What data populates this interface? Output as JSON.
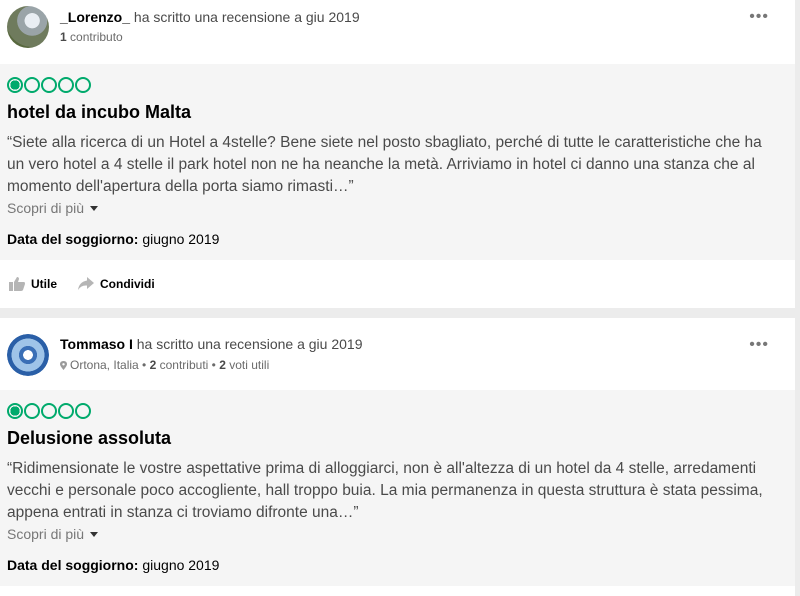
{
  "reviews": [
    {
      "username": "_Lorenzo_",
      "action": "ha scritto una recensione a giu 2019",
      "contrib_count": "1",
      "contrib_label": "contributo",
      "location": "",
      "votes_count": "",
      "votes_label": "",
      "rating": 1,
      "title": "hotel da incubo Malta",
      "text": "“Siete alla ricerca di un Hotel a 4stelle? Bene siete nel posto sbagliato, perché di tutte le caratteristiche che ha un vero hotel a 4 stelle il park hotel non ne ha neanche la metà. Arriviamo in hotel ci danno una stanza che al momento dell'apertura della porta siamo rimasti…”",
      "more_label": "Scopri di più",
      "stay_label": "Data del soggiorno:",
      "stay_value": "giugno 2019",
      "helpful_label": "Utile",
      "share_label": "Condividi"
    },
    {
      "username": "Tommaso I",
      "action": "ha scritto una recensione a giu 2019",
      "location": "Ortona, Italia",
      "contrib_count": "2",
      "contrib_label": "contributi",
      "votes_count": "2",
      "votes_label": "voti utili",
      "rating": 1,
      "title": "Delusione assoluta",
      "text": "“Ridimensionate le vostre aspettative prima di alloggiarci, non è all'altezza di un hotel da 4 stelle, arredamenti vecchi e personale poco accogliente, hall troppo buia. La mia permanenza in questa struttura è stata pessima, appena entrati in stanza ci troviamo difronte una…”",
      "more_label": "Scopri di più",
      "stay_label": "Data del soggiorno:",
      "stay_value": "giugno 2019"
    }
  ],
  "colors": {
    "bubble": "#00aa6c",
    "background": "#ececec",
    "body_bg": "#f5f5f5"
  },
  "icons": [
    "more-options-icon",
    "thumbs-up-icon",
    "share-icon",
    "location-pin-icon",
    "chevron-down-icon"
  ]
}
